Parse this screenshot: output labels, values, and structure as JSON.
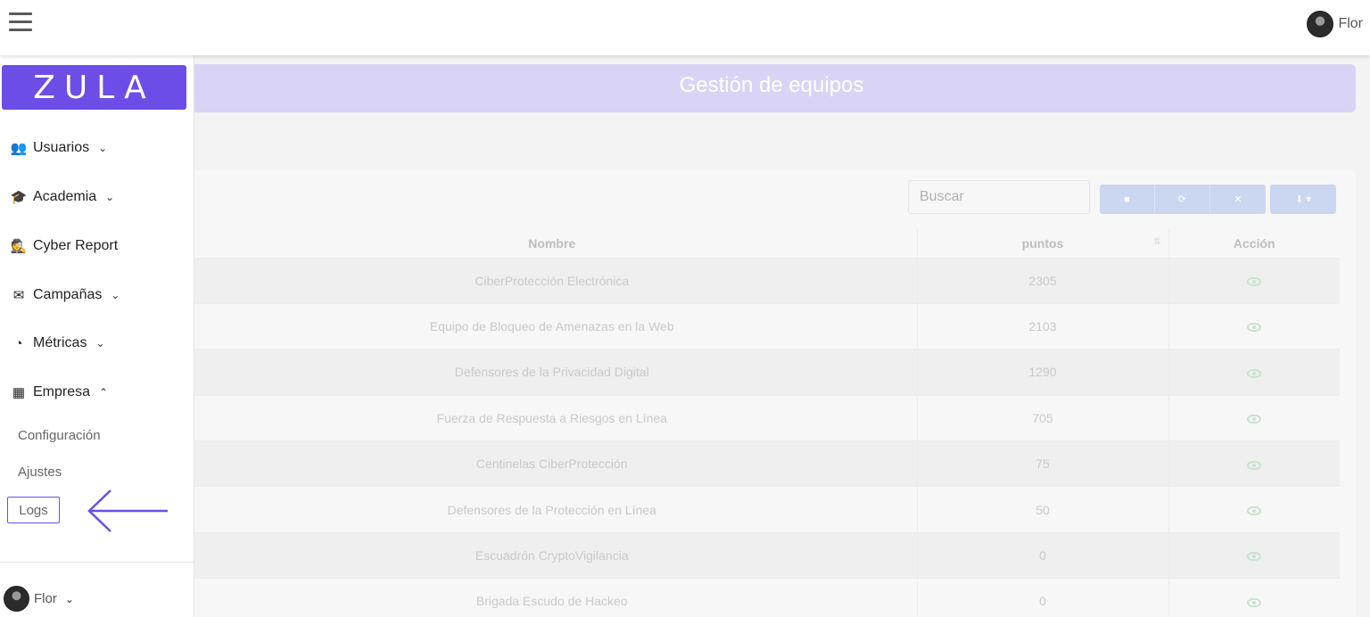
{
  "topbar": {
    "user_name": "Flor"
  },
  "sidebar": {
    "logo_text": "ZULA",
    "items": [
      {
        "label": "Usuarios",
        "icon": "users-icon"
      },
      {
        "label": "Academia",
        "icon": "graduation-icon"
      },
      {
        "label": "Cyber Report",
        "icon": "spy-icon"
      },
      {
        "label": "Campañas",
        "icon": "envelope-icon"
      },
      {
        "label": "Métricas",
        "icon": "gauge-icon"
      },
      {
        "label": "Empresa",
        "icon": "building-icon"
      }
    ],
    "sub_items": [
      {
        "label": "Configuración"
      },
      {
        "label": "Ajustes"
      },
      {
        "label": "Logs"
      }
    ],
    "user_name": "Flor"
  },
  "page": {
    "title": "Gestión de equipos"
  },
  "table": {
    "search_placeholder": "Buscar",
    "columns": [
      "Nombre",
      "puntos",
      "Acción"
    ],
    "rows": [
      {
        "name": "CiberProtección Electrónica",
        "points": "2305"
      },
      {
        "name": "Equipo de Bloqueo de Amenazas en la Web",
        "points": "2103"
      },
      {
        "name": "Defensores de la Privacidad Digital",
        "points": "1290"
      },
      {
        "name": "Fuerza de Respuesta a Riesgos en Línea",
        "points": "705"
      },
      {
        "name": "Centinelas CiberProtección",
        "points": "75"
      },
      {
        "name": "Defensores de la Protección en Línea",
        "points": "50"
      },
      {
        "name": "Escuadrón CryptoVigilancia",
        "points": "0"
      },
      {
        "name": "Brigada Escudo de Hackeo",
        "points": "0"
      }
    ]
  },
  "colors": {
    "brand": "#6c4de6",
    "header_bg": "#d9d4f5",
    "button_bg": "#cbd6f1"
  }
}
